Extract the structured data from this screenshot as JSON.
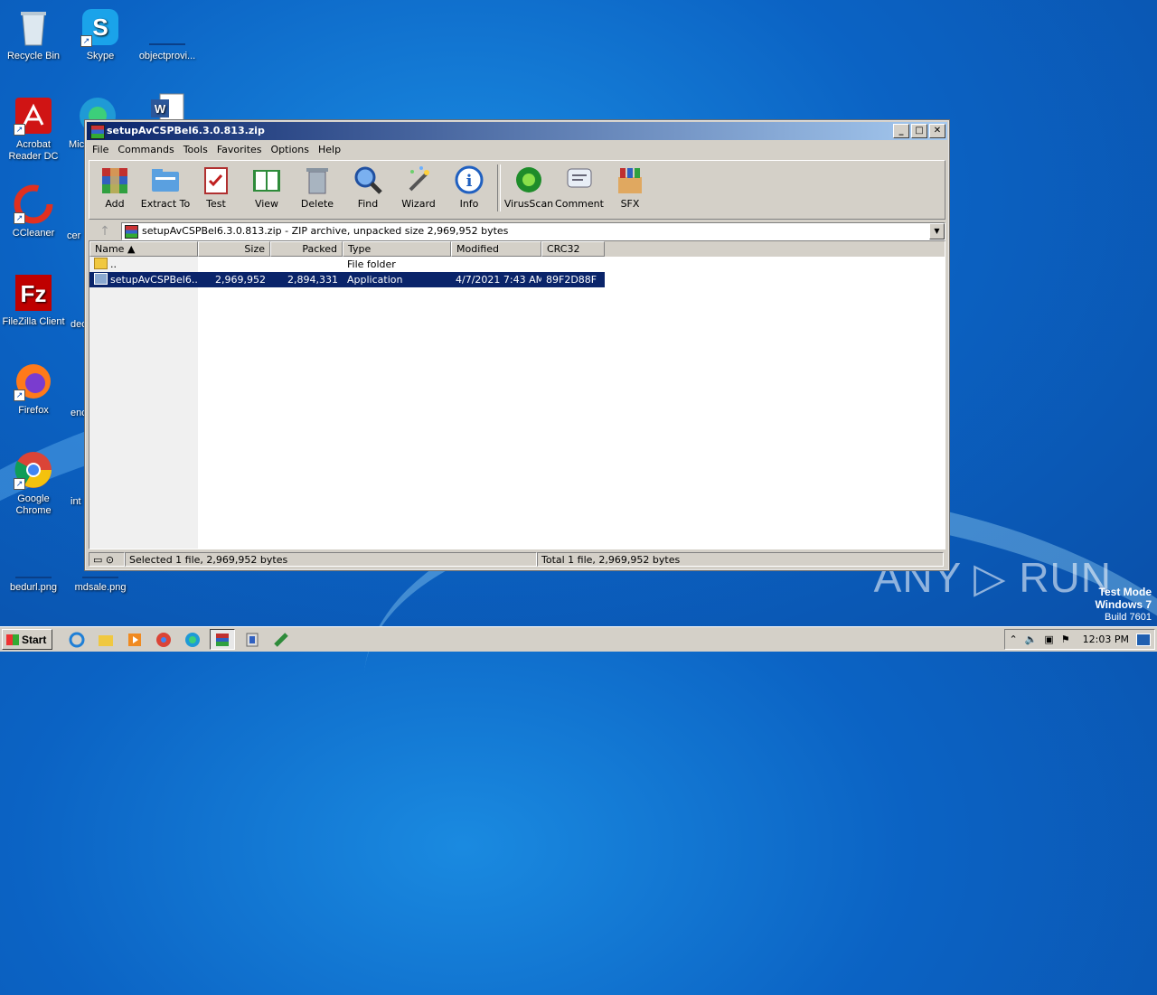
{
  "desktop": {
    "icons": [
      {
        "label": "Recycle Bin"
      },
      {
        "label": "Skype"
      },
      {
        "label": "objectprovi..."
      },
      {
        "label": "Acrobat Reader DC"
      },
      {
        "label": "Mic"
      },
      {
        "label": "CCleaner"
      },
      {
        "label": "cer"
      },
      {
        "label": "FileZilla Client"
      },
      {
        "label": "dec"
      },
      {
        "label": "Firefox"
      },
      {
        "label": "enc"
      },
      {
        "label": "Google Chrome"
      },
      {
        "label": "int"
      },
      {
        "label": "bedurl.png"
      },
      {
        "label": "mdsale.png"
      }
    ],
    "watermark": "ANY ▷ RUN",
    "test_mode": {
      "line1": "Test Mode",
      "line2": "Windows 7",
      "line3": "Build 7601"
    }
  },
  "window": {
    "title": "setupAvCSPBel6.3.0.813.zip",
    "menu": [
      "File",
      "Commands",
      "Tools",
      "Favorites",
      "Options",
      "Help"
    ],
    "toolbar": [
      {
        "label": "Add",
        "icon": "add-archive-icon"
      },
      {
        "label": "Extract To",
        "icon": "extract-folder-icon"
      },
      {
        "label": "Test",
        "icon": "test-clipboard-icon"
      },
      {
        "label": "View",
        "icon": "view-book-icon"
      },
      {
        "label": "Delete",
        "icon": "trash-icon"
      },
      {
        "label": "Find",
        "icon": "magnifier-icon"
      },
      {
        "label": "Wizard",
        "icon": "wand-icon"
      },
      {
        "label": "Info",
        "icon": "info-icon"
      },
      {
        "label": "VirusScan",
        "icon": "virus-scan-icon"
      },
      {
        "label": "Comment",
        "icon": "comment-icon"
      },
      {
        "label": "SFX",
        "icon": "sfx-box-icon"
      }
    ],
    "address": "setupAvCSPBel6.3.0.813.zip - ZIP archive, unpacked size 2,969,952 bytes",
    "columns": [
      "Name",
      "Size",
      "Packed",
      "Type",
      "Modified",
      "CRC32"
    ],
    "rows": [
      {
        "name": "..",
        "size": "",
        "packed": "",
        "type": "File folder",
        "modified": "",
        "crc": ""
      },
      {
        "name": "setupAvCSPBel6....",
        "size": "2,969,952",
        "packed": "2,894,331",
        "type": "Application",
        "modified": "4/7/2021 7:43 AM",
        "crc": "89F2D88F"
      }
    ],
    "status_left": "Selected 1 file, 2,969,952 bytes",
    "status_right": "Total 1 file, 2,969,952 bytes"
  },
  "taskbar": {
    "start": "Start",
    "clock": "12:03 PM"
  },
  "colors": {
    "selection": "#0a246a",
    "titlebar_start": "#0a246a",
    "desktop": "#0b63c4"
  }
}
